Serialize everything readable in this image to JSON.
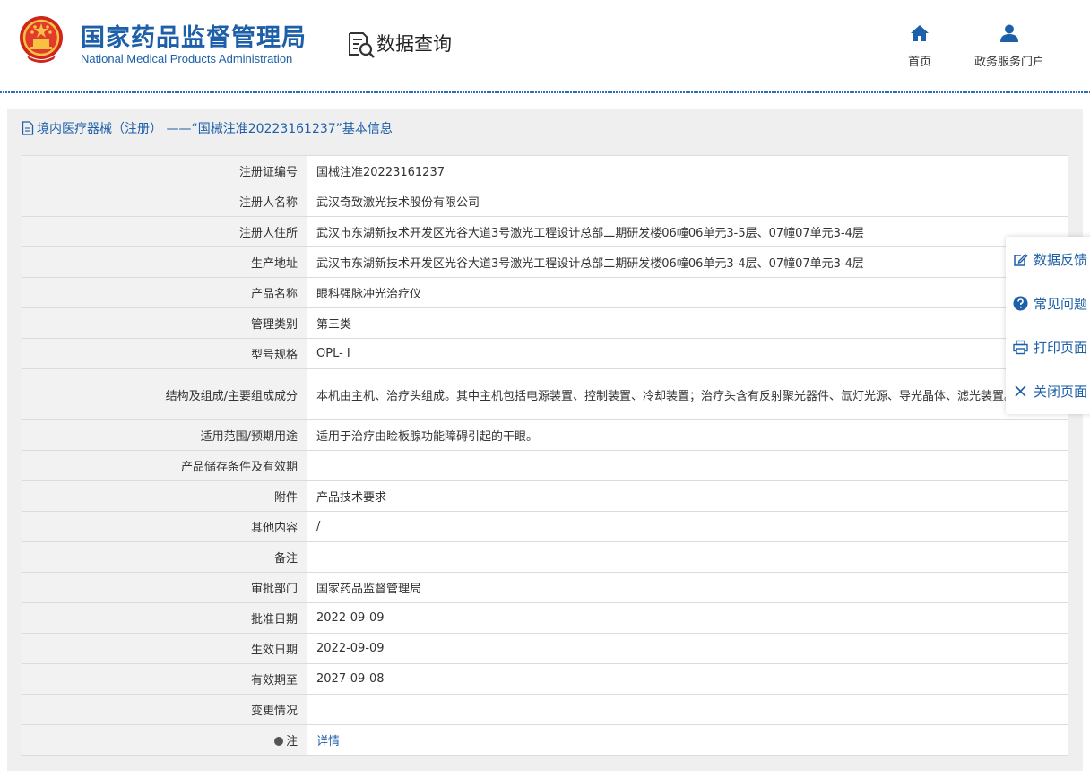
{
  "header": {
    "brand_cn": "国家药品监督管理局",
    "brand_en": "National Medical Products Administration",
    "section_title": "数据查询",
    "nav": [
      {
        "label": "首页",
        "icon": "home-icon"
      },
      {
        "label": "政务服务门户",
        "icon": "user-icon"
      }
    ]
  },
  "panel": {
    "title": "境内医疗器械（注册） ——“国械注准20223161237”基本信息"
  },
  "rows": [
    {
      "key": "注册证编号",
      "value": "国械注准20223161237"
    },
    {
      "key": "注册人名称",
      "value": "武汉奇致激光技术股份有限公司"
    },
    {
      "key": "注册人住所",
      "value": "武汉市东湖新技术开发区光谷大道3号激光工程设计总部二期研发楼06幢06单元3-5层、07幢07单元3-4层"
    },
    {
      "key": "生产地址",
      "value": "武汉市东湖新技术开发区光谷大道3号激光工程设计总部二期研发楼06幢06单元3-4层、07幢07单元3-4层"
    },
    {
      "key": "产品名称",
      "value": "眼科强脉冲光治疗仪"
    },
    {
      "key": "管理类别",
      "value": "第三类"
    },
    {
      "key": "型号规格",
      "value": "OPL- Ⅰ"
    },
    {
      "key": "结构及组成/主要组成成分",
      "value": "本机由主机、治疗头组成。其中主机包括电源装置、控制装置、冷却装置；治疗头含有反射聚光器件、氙灯光源、导光晶体、滤光装置。"
    },
    {
      "key": "适用范围/预期用途",
      "value": "适用于治疗由睑板腺功能障碍引起的干眼。"
    },
    {
      "key": "产品储存条件及有效期",
      "value": ""
    },
    {
      "key": "附件",
      "value": "产品技术要求"
    },
    {
      "key": "其他内容",
      "value": "/"
    },
    {
      "key": "备注",
      "value": ""
    },
    {
      "key": "审批部门",
      "value": "国家药品监督管理局"
    },
    {
      "key": "批准日期",
      "value": "2022-09-09"
    },
    {
      "key": "生效日期",
      "value": "2022-09-09"
    },
    {
      "key": "有效期至",
      "value": "2027-09-08"
    },
    {
      "key": "变更情况",
      "value": ""
    },
    {
      "key": "注",
      "value": "详情"
    }
  ],
  "sidebar": [
    {
      "label": "数据反馈",
      "icon": "edit-icon"
    },
    {
      "label": "常见问题",
      "icon": "question-icon"
    },
    {
      "label": "打印页面",
      "icon": "print-icon"
    },
    {
      "label": "关闭页面",
      "icon": "close-icon"
    }
  ],
  "colors": {
    "brand": "#1d5fa8",
    "label_bg": "#f2f2f2",
    "border": "#dcdcdc"
  }
}
